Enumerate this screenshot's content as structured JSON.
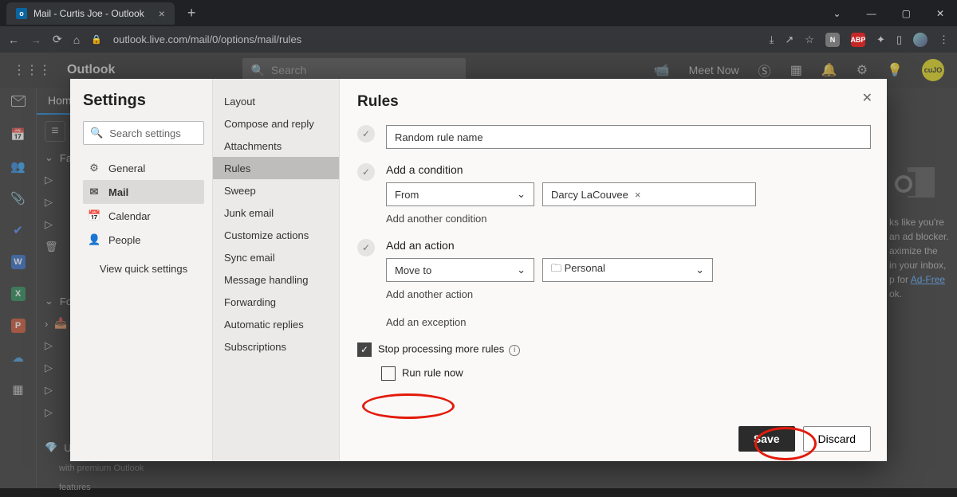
{
  "browser": {
    "tab_title": "Mail - Curtis Joe - Outlook",
    "url": "outlook.live.com/mail/0/options/mail/rules"
  },
  "header": {
    "brand": "Outlook",
    "search_placeholder": "Search",
    "meet_now": "Meet Now"
  },
  "left": {
    "home": "Home",
    "fav": "Fa",
    "fo": "Fo",
    "upgrade1": "Up",
    "upgrade2": "with premium Outlook",
    "upgrade3": "features"
  },
  "settings": {
    "title": "Settings",
    "search_placeholder": "Search settings",
    "cats": {
      "general": "General",
      "mail": "Mail",
      "calendar": "Calendar",
      "people": "People"
    },
    "view_quick": "View quick settings",
    "sub": {
      "layout": "Layout",
      "compose": "Compose and reply",
      "attachments": "Attachments",
      "rules": "Rules",
      "sweep": "Sweep",
      "junk": "Junk email",
      "customize": "Customize actions",
      "sync": "Sync email",
      "message": "Message handling",
      "forward": "Forwarding",
      "auto": "Automatic replies",
      "subs": "Subscriptions"
    }
  },
  "rules": {
    "title": "Rules",
    "name": "Random rule name",
    "add_condition": "Add a condition",
    "cond_drop": "From",
    "cond_chip": "Darcy LaCouvee",
    "add_another_cond": "Add another condition",
    "add_action": "Add an action",
    "action_drop": "Move to",
    "action_folder": "Personal",
    "add_another_action": "Add another action",
    "add_exception": "Add an exception",
    "stop": "Stop processing more rules",
    "run_now": "Run rule now",
    "save": "Save",
    "discard": "Discard"
  },
  "ad": {
    "l1": "ks like you're",
    "l2": "an ad blocker.",
    "l3": "aximize the",
    "l4": "in your inbox,",
    "l5": "p for ",
    "link": "Ad-Free",
    "l6": "ok"
  }
}
